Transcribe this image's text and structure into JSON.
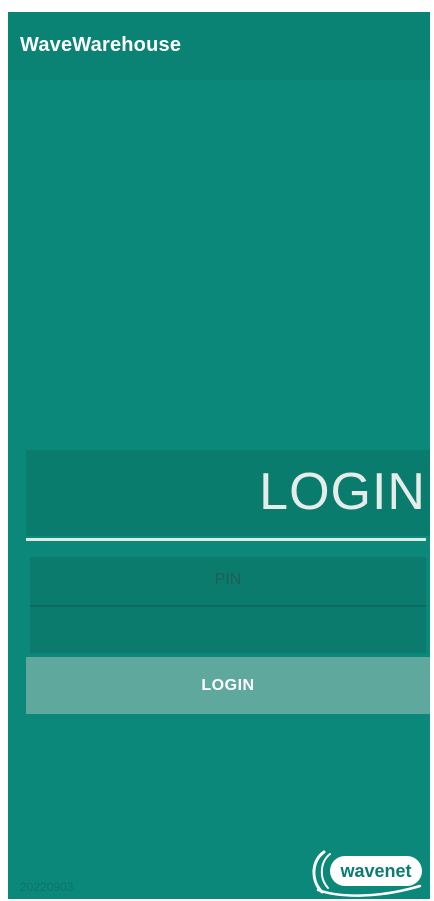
{
  "app_bar": {
    "title": "WaveWarehouse"
  },
  "login": {
    "heading": "LOGIN",
    "pin_label": "PIN",
    "pin_value": "",
    "button_label": "LOGIN"
  },
  "footer": {
    "version": "20220903",
    "logo_text": "wavenet"
  },
  "colors": {
    "background": "#0b887a",
    "app_bar": "#0a8374",
    "panel": "#0a7b6d",
    "button": "#5fa89d",
    "text_light": "#e6ece9"
  }
}
